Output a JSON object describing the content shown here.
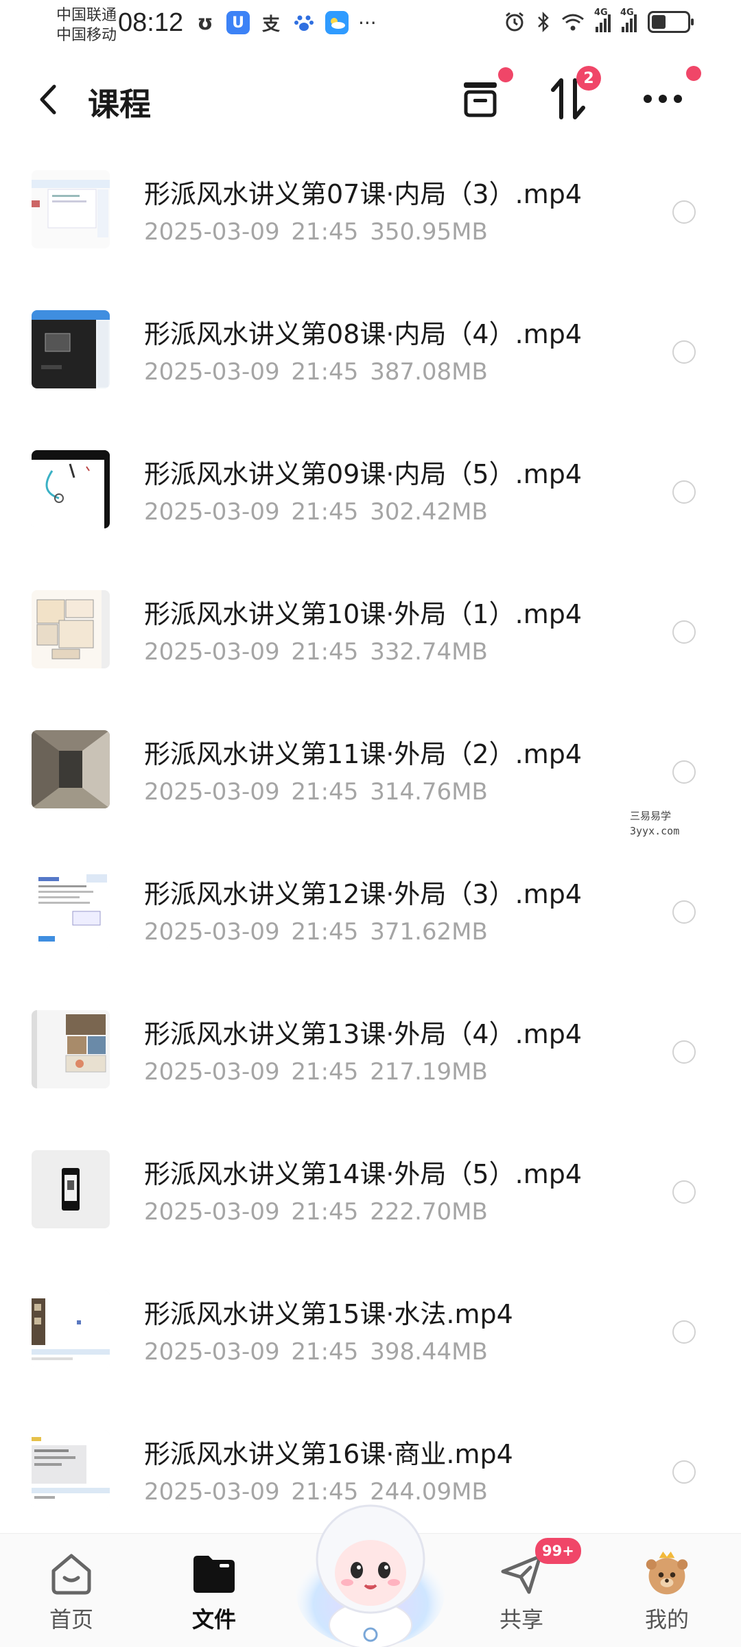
{
  "status": {
    "carrier1": "中国联通",
    "carrier2": "中国移动",
    "time": "08:12",
    "apps": [
      {
        "icon": "u-app-icon",
        "glyph": "ʊ",
        "color": "#ffffff"
      },
      {
        "icon": "u-blue-app-icon",
        "glyph": "U",
        "color": "#3c82f6"
      },
      {
        "icon": "alipay-icon",
        "glyph": "支",
        "color": "#ffffff"
      },
      {
        "icon": "baidu-icon",
        "glyph": "🐾",
        "color": "#ffffff"
      },
      {
        "icon": "weather-icon",
        "glyph": "☁",
        "color": "#2f9bff"
      }
    ],
    "more": "···",
    "net1": "4G",
    "net2": "4G",
    "battery_level": 0.4
  },
  "header": {
    "title": "课程",
    "sort_badge": "2"
  },
  "files": [
    {
      "name": "形派风水讲义第07课·内局（3）.mp4",
      "date": "2025-03-09",
      "time": "21:45",
      "size": "350.95MB",
      "thumb": "screen-light"
    },
    {
      "name": "形派风水讲义第08课·内局（4）.mp4",
      "date": "2025-03-09",
      "time": "21:45",
      "size": "387.08MB",
      "thumb": "screen-dark"
    },
    {
      "name": "形派风水讲义第09课·内局（5）.mp4",
      "date": "2025-03-09",
      "time": "21:45",
      "size": "302.42MB",
      "thumb": "drawing"
    },
    {
      "name": "形派风水讲义第10课·外局（1）.mp4",
      "date": "2025-03-09",
      "time": "21:45",
      "size": "332.74MB",
      "thumb": "floorplan"
    },
    {
      "name": "形派风水讲义第11课·外局（2）.mp4",
      "date": "2025-03-09",
      "time": "21:45",
      "size": "314.76MB",
      "thumb": "corridor"
    },
    {
      "name": "形派风水讲义第12课·外局（3）.mp4",
      "date": "2025-03-09",
      "time": "21:45",
      "size": "371.62MB",
      "thumb": "document"
    },
    {
      "name": "形派风水讲义第13课·外局（4）.mp4",
      "date": "2025-03-09",
      "time": "21:45",
      "size": "217.19MB",
      "thumb": "photos"
    },
    {
      "name": "形派风水讲义第14课·外局（5）.mp4",
      "date": "2025-03-09",
      "time": "21:45",
      "size": "222.70MB",
      "thumb": "phone"
    },
    {
      "name": "形派风水讲义第15课·水法.mp4",
      "date": "2025-03-09",
      "time": "21:45",
      "size": "398.44MB",
      "thumb": "building"
    },
    {
      "name": "形派风水讲义第16课·商业.mp4",
      "date": "2025-03-09",
      "time": "21:45",
      "size": "244.09MB",
      "thumb": "chat"
    }
  ],
  "watermark": {
    "line1": "三易易学",
    "line2": "3yyx.com"
  },
  "nav": {
    "home": "首页",
    "files": "文件",
    "share": "共享",
    "share_badge": "99+",
    "mine": "我的"
  },
  "colors": {
    "accent": "#f04668",
    "meta_text": "#a5a5a5"
  }
}
